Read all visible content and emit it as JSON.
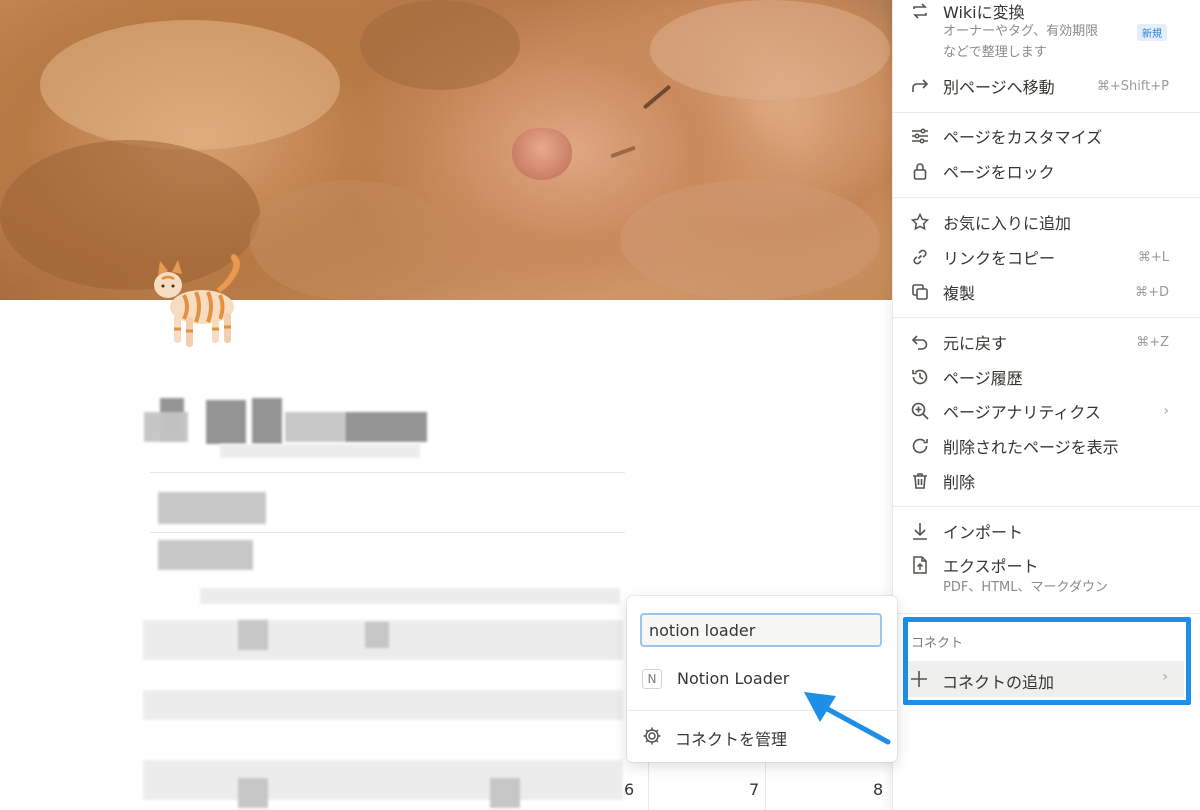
{
  "menu": {
    "items": [
      {
        "label": "Wikiに変換",
        "subtitle_1": "オーナーやタグ、有効期限",
        "subtitle_2": "などで整理します",
        "badge": "新規",
        "icon": "wiki-convert-icon"
      },
      {
        "label": "別ページへ移動",
        "shortcut": "⌘+Shift+P",
        "icon": "move-arrow-icon"
      },
      {
        "label": "ページをカスタマイズ",
        "icon": "sliders-icon"
      },
      {
        "label": "ページをロック",
        "icon": "lock-icon"
      },
      {
        "label": "お気に入りに追加",
        "icon": "star-icon"
      },
      {
        "label": "リンクをコピー",
        "shortcut": "⌘+L",
        "icon": "link-icon"
      },
      {
        "label": "複製",
        "shortcut": "⌘+D",
        "icon": "duplicate-icon"
      },
      {
        "label": "元に戻す",
        "shortcut": "⌘+Z",
        "icon": "undo-icon"
      },
      {
        "label": "ページ履歴",
        "icon": "history-icon"
      },
      {
        "label": "ページアナリティクス",
        "icon": "analytics-zoom-icon"
      },
      {
        "label": "削除されたページを表示",
        "icon": "restore-icon"
      },
      {
        "label": "削除",
        "icon": "trash-icon"
      },
      {
        "label": "インポート",
        "icon": "import-icon"
      },
      {
        "label": "エクスポート",
        "subtitle": "PDF、HTML、マークダウン",
        "icon": "export-icon"
      }
    ],
    "connect": {
      "section_label": "コネクト",
      "add_label": "コネクトの追加"
    }
  },
  "popover": {
    "search_value": "notion loader",
    "result_label": "Notion Loader",
    "result_logo": "N",
    "manage_label": "コネクトを管理"
  },
  "calendar": {
    "days": [
      "6",
      "7",
      "8"
    ]
  },
  "colors": {
    "highlight": "#1d8fe8",
    "arrow": "#1d8fe8",
    "badge_bg": "#e3eefa",
    "badge_text": "#2e80d6"
  }
}
